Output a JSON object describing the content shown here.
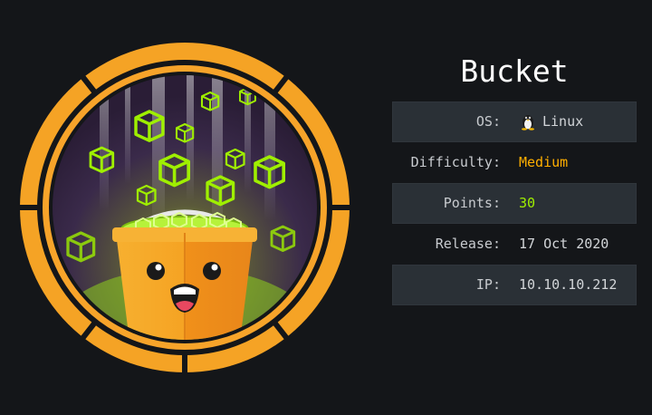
{
  "machine": {
    "name": "Bucket",
    "icon": "bucket-badge-icon"
  },
  "info": [
    {
      "label": "OS:",
      "value": "Linux",
      "icon": "linux-tux-icon"
    },
    {
      "label": "Difficulty:",
      "value": "Medium",
      "color": "#ffaf00"
    },
    {
      "label": "Points:",
      "value": "30",
      "color": "#9fef00"
    },
    {
      "label": "Release:",
      "value": "17 Oct 2020"
    },
    {
      "label": "IP:",
      "value": "10.10.10.212"
    }
  ],
  "colors": {
    "background": "#141619",
    "row_shaded": "#2a3036",
    "badge_ring": "#f7a42a",
    "cube_green": "#9fef00"
  }
}
